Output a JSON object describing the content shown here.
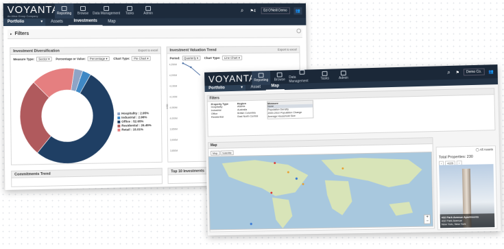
{
  "app": {
    "logo": "VOYANTA",
    "tagline": "An Altus Group Company"
  },
  "back": {
    "nav": [
      "Reporting",
      "Browse",
      "Data Management",
      "Tasks",
      "Admin"
    ],
    "user": "Ed O'Neill Demo",
    "subnav": {
      "portfolio": "Portfolio",
      "tabs": [
        "Assets",
        "Investments",
        "Map"
      ]
    },
    "filters": "Filters",
    "diversification": {
      "title": "Investment Diversification",
      "export": "Export to excel",
      "measure_label": "Measure Type:",
      "measure_value": "Sector",
      "pv_label": "Percentage or Value:",
      "pv_value": "Percentage",
      "chart_label": "Chart Type:",
      "chart_value": "Pie Chart",
      "legend": [
        "Hospitality : 2.95%",
        "Industrial : 2.96%",
        "Office : 52.65%",
        "Residential : 26.45%",
        "Retail : 15.01%"
      ]
    },
    "valuation": {
      "title": "Investment Valuation Trend",
      "export": "Export to excel",
      "period_label": "Period:",
      "period_value": "Quarterly",
      "chart_label": "Chart Type:",
      "chart_value": "Line Chart",
      "ylabel": "USD",
      "yticks": [
        "4,250M",
        "4,200M",
        "4,150M",
        "4,100M",
        "4,050M",
        "4,000M",
        "3,950M",
        "3,900M",
        "3,850M"
      ]
    },
    "bottom_left": "Commitments Trend",
    "bottom_right": "Top 10 Investments"
  },
  "front": {
    "logo": "VOYANTA",
    "nav": [
      "Reporting",
      "Browse",
      "Data Management",
      "Tasks",
      "Admin"
    ],
    "user": "Demo Co.",
    "subnav": {
      "portfolio": "Portfolio",
      "tabs": [
        "Asset",
        "Map"
      ]
    },
    "filters": {
      "title": "Filters",
      "type": {
        "title": "Property Type",
        "items": [
          "Hospitality",
          "Industrial",
          "Office",
          "Residential"
        ]
      },
      "region": {
        "title": "Region",
        "items": [
          "Atlanta",
          "Australia",
          "British Columbia",
          "East North Central"
        ]
      },
      "measure": {
        "title": "Measure",
        "items": [
          "None",
          "Population Density",
          "2000-2010 Population Change",
          "Average Household Size"
        ]
      }
    },
    "map": {
      "title": "Map",
      "tabs": [
        "Map",
        "Satellite"
      ]
    },
    "all_assets": "All Assets",
    "total": "Total Properties: 230",
    "pager": "4225",
    "property": {
      "name": "432 Park Avenue Apartments",
      "address": "432 Park Avenue",
      "city": "New York, New York"
    }
  },
  "chart_data": {
    "type": "pie",
    "categories": [
      "Hospitality",
      "Industrial",
      "Office",
      "Residential",
      "Retail"
    ],
    "values": [
      2.95,
      2.96,
      52.65,
      26.45,
      15.01
    ],
    "colors": [
      "#8fa4c6",
      "#3f88c5",
      "#1f3f64",
      "#b05a5d",
      "#e57f80"
    ]
  }
}
